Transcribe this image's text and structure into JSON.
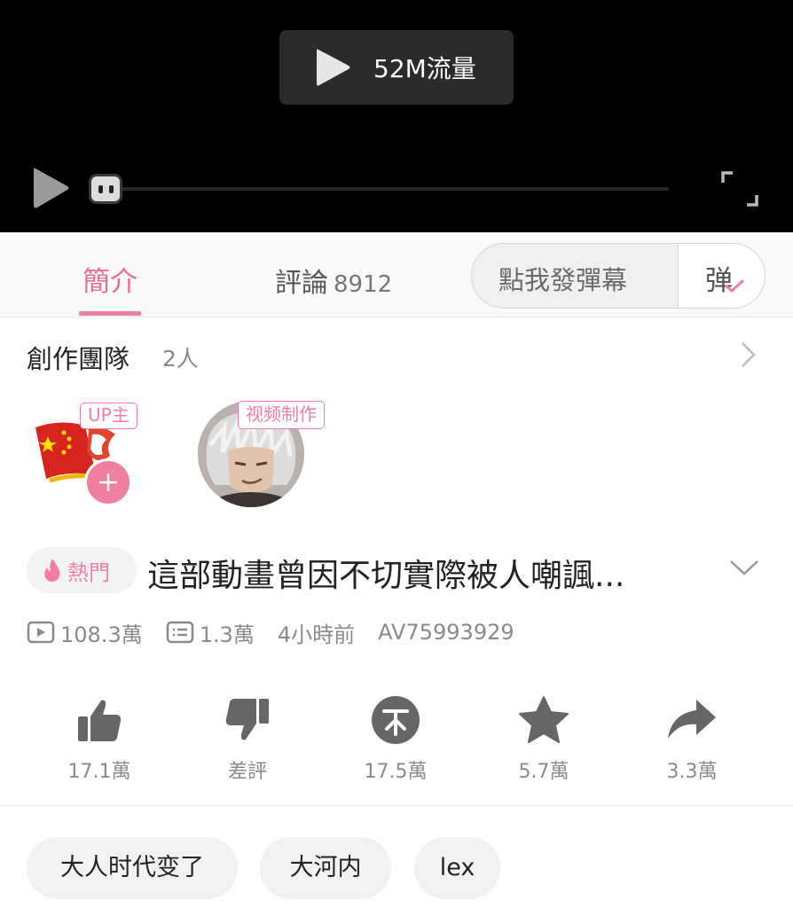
{
  "player": {
    "play_data_label": "52M流量"
  },
  "tabs": {
    "intro": "簡介",
    "comments": "評論",
    "comments_count": "8912",
    "danmaku_placeholder": "點我發彈幕",
    "danmaku_button": "弹"
  },
  "team": {
    "title": "創作團隊",
    "count": "2人",
    "members": [
      {
        "role": "UP主"
      },
      {
        "role": "视频制作"
      }
    ]
  },
  "video": {
    "hot_badge": "熱門",
    "title": "這部動畫曾因不切實際被人嘲諷...",
    "views": "108.3萬",
    "danmaku_count": "1.3萬",
    "time": "4小時前",
    "av": "AV75993929"
  },
  "actions": {
    "like": "17.1萬",
    "dislike": "差評",
    "coin": "17.5萬",
    "favorite": "5.7萬",
    "share": "3.3萬"
  },
  "tags": [
    "大人时代变了",
    "大河内",
    "lex"
  ],
  "colors": {
    "accent": "#f07fa0",
    "player_bg": "#000000"
  }
}
